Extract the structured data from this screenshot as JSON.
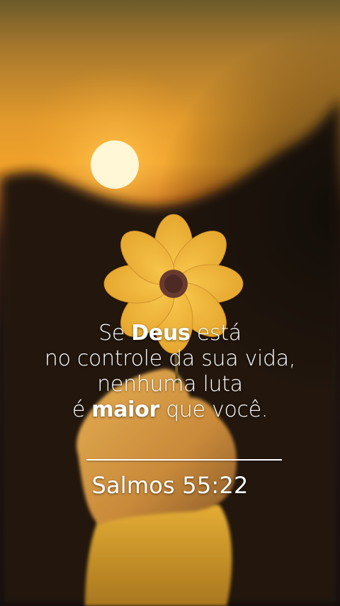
{
  "quote": {
    "line1_pre": "Se ",
    "line1_bold": "Deus",
    "line1_post": " está",
    "line2": "no controle da sua vida,",
    "line3": "nenhuma luta",
    "line4_pre": "é ",
    "line4_bold": "maior",
    "line4_post": " que você."
  },
  "reference": "Salmos 55:22",
  "colors": {
    "text": "#ffffff",
    "sky_top": "#6e5a24",
    "sun_glow": "#f0a02a",
    "petal": "#f2b536",
    "flower_center": "#6a3a2e",
    "sleeve": "#e0a52e"
  }
}
